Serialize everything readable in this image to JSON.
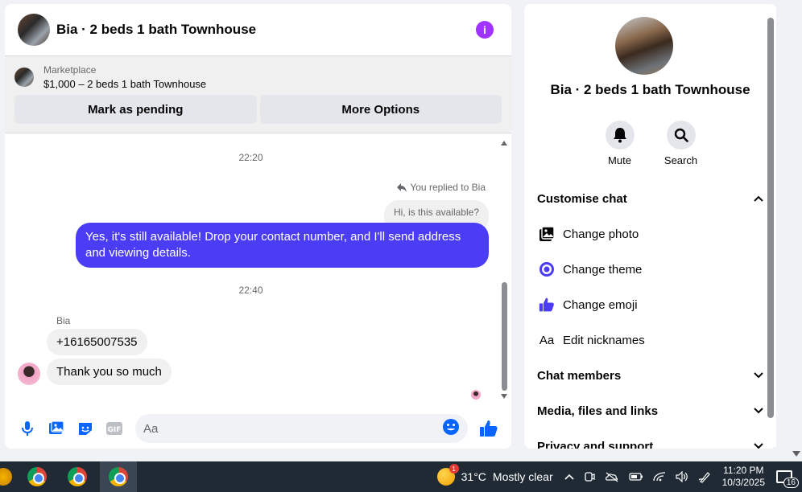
{
  "chat": {
    "title": "Bia · 2 beds 1 bath Townhouse",
    "marketplace_label": "Marketplace",
    "listing": "$1,000 – 2 beds 1 bath Townhouse",
    "btn_pending": "Mark as pending",
    "btn_more": "More Options",
    "time1": "22:20",
    "replied": "You replied to Bia",
    "quoted": "Hi, is this available?",
    "outgoing": "Yes, it's still available! Drop your contact number, and I'll send address and viewing details.",
    "time2": "22:40",
    "sender": "Bia",
    "in1": "+16165007535",
    "in2": "Thank you so much",
    "input_placeholder": "Aa"
  },
  "side": {
    "title": "Bia · 2 beds 1 bath Townhouse",
    "mute": "Mute",
    "search": "Search",
    "customise": "Customise chat",
    "change_photo": "Change photo",
    "change_theme": "Change theme",
    "change_emoji": "Change emoji",
    "edit_nicknames": "Edit nicknames",
    "chat_members": "Chat members",
    "media": "Media, files and links",
    "privacy": "Privacy and support"
  },
  "taskbar": {
    "weather_temp": "31°C",
    "weather_desc": "Mostly clear",
    "weather_badge": "1",
    "time": "11:20 PM",
    "date": "10/3/2025",
    "notifications": "16"
  },
  "colors": {
    "accent": "#4b3cf5",
    "messenger_blue": "#0866ff",
    "info_purple": "#a033ff"
  }
}
